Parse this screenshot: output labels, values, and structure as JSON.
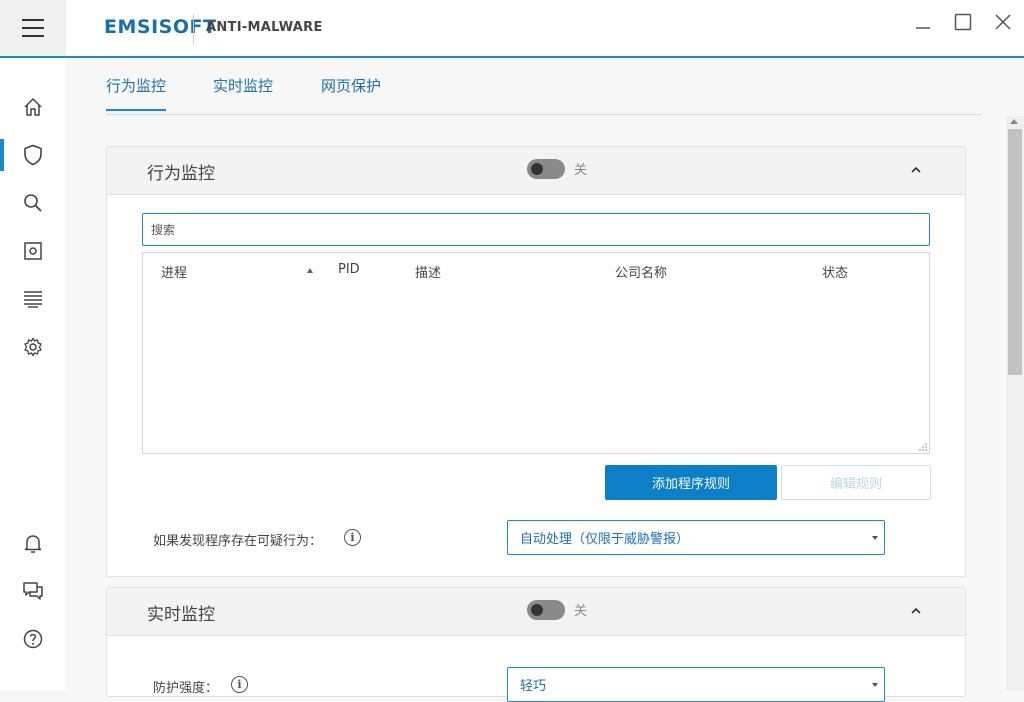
{
  "app": {
    "logo": "EMSISOFT",
    "product": "ANTI-MALWARE"
  },
  "window_controls": {
    "minimize_icon": "minimize-icon",
    "maximize_icon": "maximize-icon",
    "close_icon": "close-icon"
  },
  "sidebar": {
    "items": [
      {
        "icon": "home-icon"
      },
      {
        "icon": "shield-icon",
        "active": true
      },
      {
        "icon": "search-icon"
      },
      {
        "icon": "quarantine-icon"
      },
      {
        "icon": "logs-icon"
      },
      {
        "icon": "settings-icon"
      },
      {
        "icon": "bell-icon"
      },
      {
        "icon": "chat-icon"
      },
      {
        "icon": "help-icon"
      }
    ]
  },
  "tabs": [
    {
      "label": "行为监控",
      "active": true
    },
    {
      "label": "实时监控"
    },
    {
      "label": "网页保护"
    }
  ],
  "behavior_card": {
    "title": "行为监控",
    "toggle_label": "关",
    "search_placeholder": "搜索",
    "columns": [
      "进程",
      "PID",
      "描述",
      "公司名称",
      "状态"
    ],
    "add_rule_button": "添加程序规则",
    "edit_rule_button": "编辑规则",
    "suspicious_label": "如果发现程序存在可疑行为：",
    "suspicious_select": "自动处理（仅限于威胁警报）"
  },
  "realtime_card": {
    "title": "实时监控",
    "toggle_label": "关",
    "protection_label": "防护强度：",
    "protection_select": "轻巧"
  },
  "colors": {
    "accent": "#1e88c8",
    "primary_button": "#0c7fc8"
  }
}
